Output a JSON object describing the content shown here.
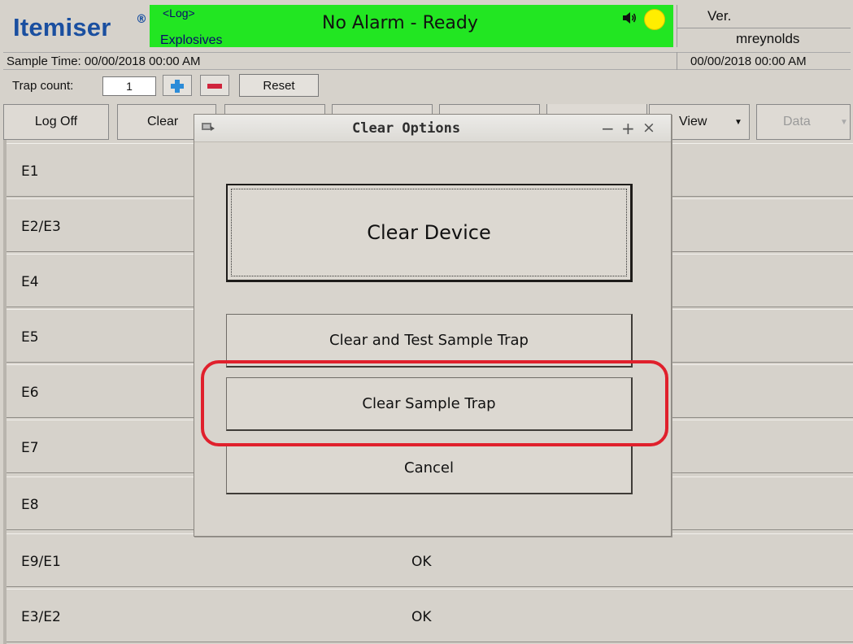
{
  "header": {
    "logo_text": "Itemiser",
    "logo_mark": "®",
    "log_tag": "<Log>",
    "mode": "Explosives",
    "alarm_status": "No Alarm - Ready",
    "speaker_icon": "speaker-icon",
    "status_light_color": "#ffee00",
    "status_bar_color": "#22e622",
    "version_label": "Ver.",
    "user": "mreynolds",
    "sample_time": "Sample Time:  00/00/2018 00:00 AM",
    "current_datetime": "00/00/2018 00:00 AM"
  },
  "trap": {
    "label": "Trap count:",
    "value": "1",
    "reset_label": "Reset"
  },
  "toolbar": {
    "log_off": "Log Off",
    "clear": "Clear",
    "view": "View",
    "data": "Data"
  },
  "rows": [
    {
      "label": "E1",
      "status": ""
    },
    {
      "label": "E2/E3",
      "status": ""
    },
    {
      "label": "E4",
      "status": ""
    },
    {
      "label": "E5",
      "status": ""
    },
    {
      "label": "E6",
      "status": ""
    },
    {
      "label": "E7",
      "status": ""
    },
    {
      "label": "E8",
      "status": ""
    },
    {
      "label": "E9/E1",
      "status": "OK"
    },
    {
      "label": "E3/E2",
      "status": "OK"
    }
  ],
  "dialog": {
    "title": "Clear Options",
    "min": "−",
    "max": "+",
    "close": "×",
    "clear_device": "Clear Device",
    "clear_and_test": "Clear and Test Sample Trap",
    "clear_sample_trap": "Clear Sample Trap",
    "cancel": "Cancel",
    "highlight_color": "#e0202c"
  }
}
